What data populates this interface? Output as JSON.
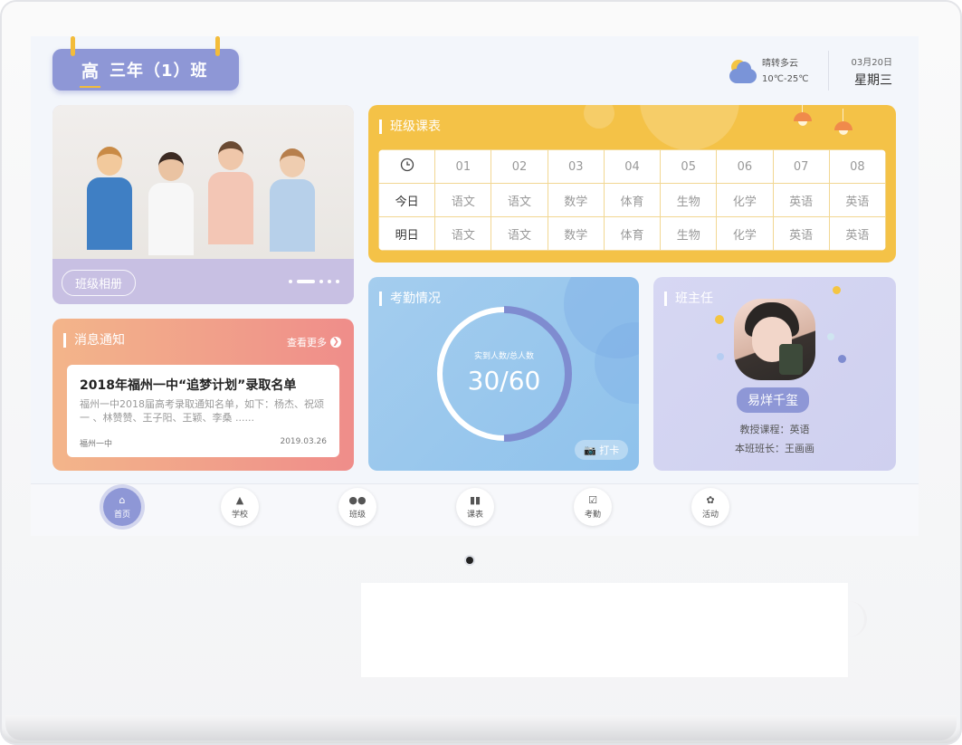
{
  "header": {
    "grade": "高",
    "class_name": "三年（1）班",
    "weather": {
      "condition": "晴转多云",
      "temperature": "10℃-25℃"
    },
    "date": {
      "day": "03月20日",
      "weekday": "星期三"
    }
  },
  "album": {
    "button_label": "班级相册",
    "pages": 5,
    "active_page": 2
  },
  "schedule": {
    "title": "班级课表",
    "periods": [
      "01",
      "02",
      "03",
      "04",
      "05",
      "06",
      "07",
      "08"
    ],
    "rows": [
      {
        "label": "今日",
        "subjects": [
          "语文",
          "语文",
          "数学",
          "体育",
          "生物",
          "化学",
          "英语",
          "英语"
        ]
      },
      {
        "label": "明日",
        "subjects": [
          "语文",
          "语文",
          "数学",
          "体育",
          "生物",
          "化学",
          "英语",
          "英语"
        ]
      }
    ]
  },
  "notice": {
    "title": "消息通知",
    "more_label": "查看更多",
    "item": {
      "headline": "2018年福州一中“追梦计划”录取名单",
      "body": "福州一中2018届高考录取通知名单，如下：杨杰、祝颂一 、林赞赞、王子阳、王颖、李桑 ......",
      "source": "福州一中",
      "date": "2019.03.26"
    }
  },
  "attendance": {
    "title": "考勤情况",
    "caption": "实到人数/总人数",
    "value_text": "30/60",
    "present": 30,
    "total": 60,
    "punch_label": "打卡"
  },
  "teacher": {
    "title": "班主任",
    "name": "易烊千玺",
    "course": "教授课程：英语",
    "monitor": "本班班长：王画画"
  },
  "nav": [
    {
      "label": "首页",
      "icon": "home-icon",
      "active": true
    },
    {
      "label": "学校",
      "icon": "school-icon",
      "active": false
    },
    {
      "label": "班级",
      "icon": "class-icon",
      "active": false
    },
    {
      "label": "课表",
      "icon": "book-icon",
      "active": false
    },
    {
      "label": "考勤",
      "icon": "calendar-check-icon",
      "active": false
    },
    {
      "label": "活动",
      "icon": "activity-icon",
      "active": false
    }
  ],
  "colors": {
    "accent_purple": "#8e97d6",
    "schedule_yellow": "#f4c247",
    "notice_gradient": [
      "#f3b58a",
      "#ef8d8a"
    ],
    "attendance_blue": "#a4cdee",
    "ring_progress": "#7f8cd0"
  }
}
